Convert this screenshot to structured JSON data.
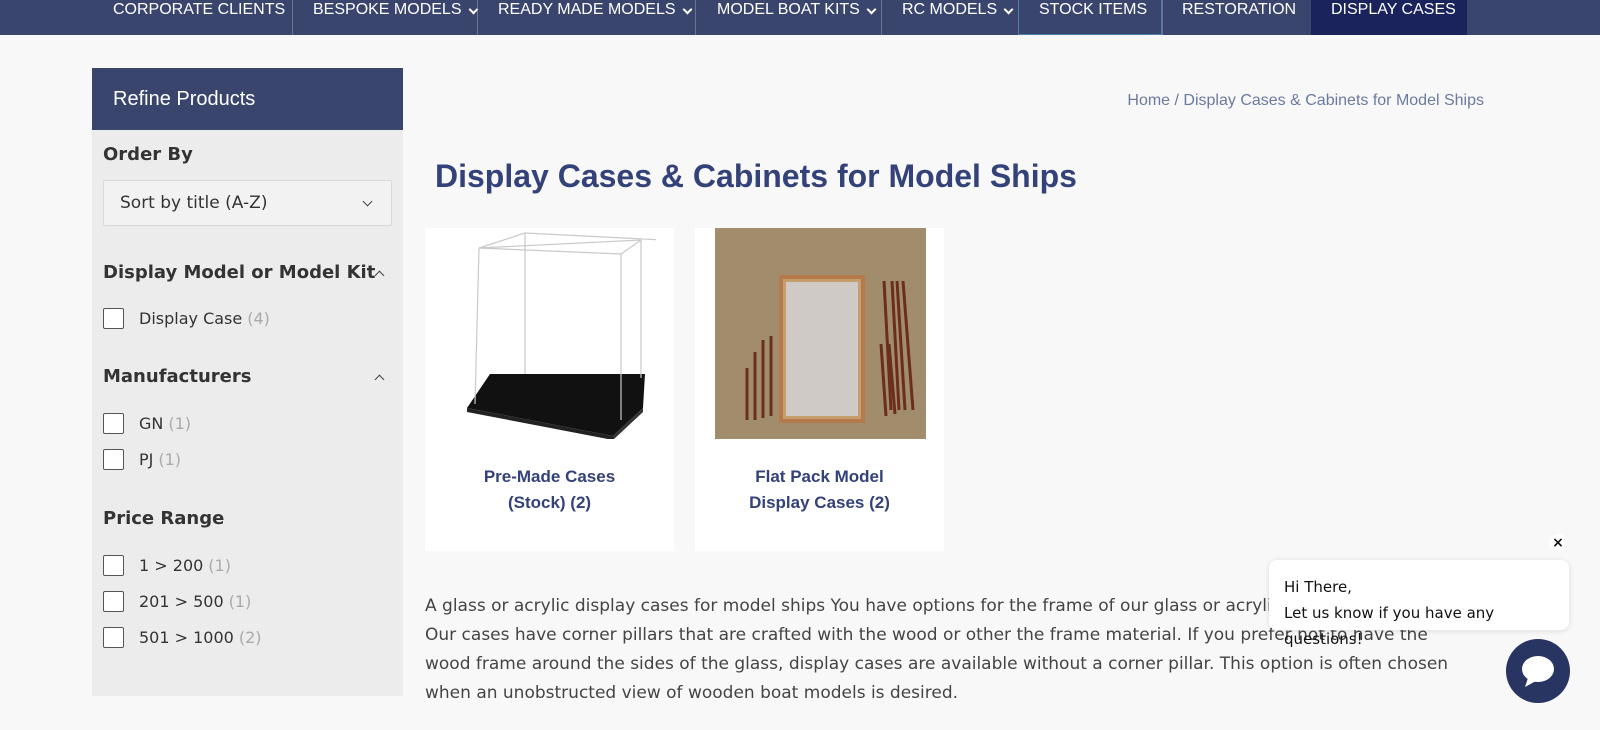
{
  "nav": {
    "items": [
      {
        "label": "CORPORATE CLIENTS",
        "dropdown": false
      },
      {
        "label": "BESPOKE MODELS",
        "dropdown": true
      },
      {
        "label": "READY MADE MODELS",
        "dropdown": true
      },
      {
        "label": "MODEL BOAT KITS",
        "dropdown": true
      },
      {
        "label": "RC MODELS",
        "dropdown": true
      },
      {
        "label": "STOCK ITEMS",
        "dropdown": false
      },
      {
        "label": "RESTORATION",
        "dropdown": false
      },
      {
        "label": "DISPLAY CASES",
        "dropdown": false,
        "active": true
      }
    ],
    "icons": {
      "dropdown": "chevron-down-icon"
    }
  },
  "sidebar": {
    "title": "Refine Products",
    "order_by": {
      "title": "Order By",
      "selected": "Sort by title (A-Z)"
    },
    "display_model": {
      "title": "Display Model or Model Kit",
      "options": [
        {
          "label": "Display Case",
          "count": "(4)"
        }
      ]
    },
    "manufacturers": {
      "title": "Manufacturers",
      "options": [
        {
          "label": "GN",
          "count": "(1)"
        },
        {
          "label": "PJ",
          "count": "(1)"
        }
      ]
    },
    "price_range": {
      "title": "Price Range",
      "options": [
        {
          "label": "1 > 200",
          "count": "(1)"
        },
        {
          "label": "201 > 500",
          "count": "(1)"
        },
        {
          "label": "501 > 1000",
          "count": "(2)"
        }
      ]
    }
  },
  "breadcrumb": {
    "home": "Home",
    "separator": " / ",
    "current": "Display Cases & Cabinets for Model Ships"
  },
  "page": {
    "title": "Display Cases & Cabinets for Model Ships"
  },
  "categories": [
    {
      "line1": "Pre-Made Cases",
      "line2": "(Stock) (2)"
    },
    {
      "line1": "Flat Pack Model",
      "line2": "Display Cases (2)"
    }
  ],
  "description": "A glass or acrylic display cases for model ships You have options for the frame of our glass or acrylic model display cases. Our cases have corner pillars that are crafted with the wood or other the frame material. If you prefer not to have the wood frame around the sides of the glass, display cases are available without a corner pillar. This option is often chosen when an unobstructed view of wooden boat models is desired.",
  "chat": {
    "close": "×",
    "line1": "Hi There,",
    "line2": "Let us know if you have any questions!"
  },
  "colors": {
    "nav_bg": "#3a456e",
    "nav_active": "#1a235c",
    "title": "#34427a",
    "chat_button": "#283462"
  }
}
